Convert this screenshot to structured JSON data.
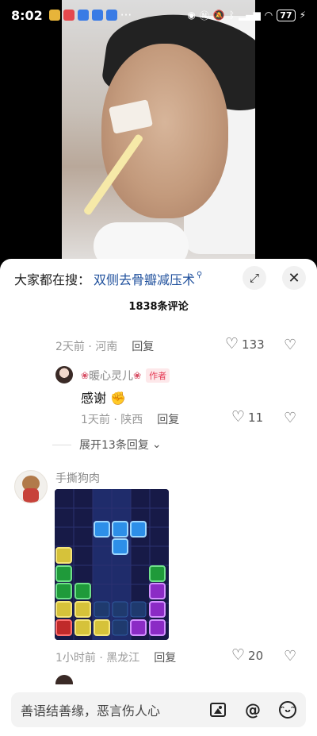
{
  "status_bar": {
    "time": "8:02",
    "battery": "77"
  },
  "search": {
    "prefix": "大家都在搜：",
    "term": "双侧去骨瓣减压术"
  },
  "comments_header": {
    "count_label": "1838条评论"
  },
  "clipped_comment": {
    "meta": "2天前 · 河南",
    "reply_label": "回复",
    "likes": "133"
  },
  "author_reply": {
    "name": "暖心灵儿",
    "badge": "作者",
    "text": "感谢",
    "meta": "1天前 · 陕西",
    "reply_label": "回复",
    "likes": "11"
  },
  "expand_replies": {
    "label": "展开13条回复"
  },
  "comment2": {
    "user": "手撕狗肉",
    "meta": "1小时前 · 黑龙江",
    "reply_label": "回复",
    "likes": "20"
  },
  "input": {
    "placeholder": "善语结善缘，恶言伤人心"
  },
  "colors": {
    "link_blue": "#1e4f9c",
    "author_red": "#e53954"
  }
}
